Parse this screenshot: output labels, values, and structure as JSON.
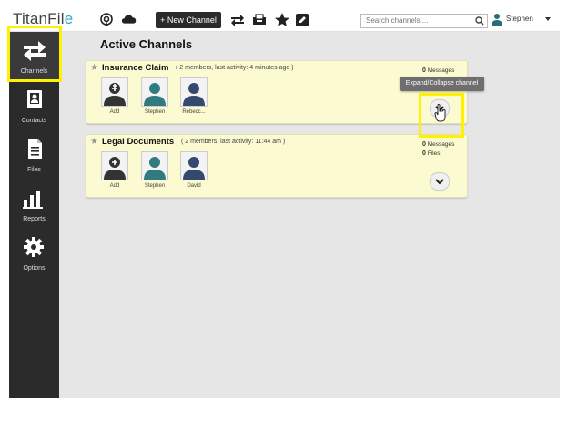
{
  "app": {
    "logo_text": "TitanFil",
    "logo_accent": "e"
  },
  "toolbar": {
    "new_channel_label": "+ New Channel",
    "search_placeholder": "Search channels ...",
    "user_name": "Stephen",
    "icons": [
      "broadcast-icon",
      "cloud-icon",
      "transfer-icon",
      "inbox-icon",
      "star-icon",
      "edit-icon",
      "search-icon",
      "user-icon"
    ]
  },
  "sidebar": {
    "items": [
      {
        "label": "Channels",
        "icon": "channels-icon",
        "active": true
      },
      {
        "label": "Contacts",
        "icon": "contacts-icon"
      },
      {
        "label": "Files",
        "icon": "files-icon"
      },
      {
        "label": "Reports",
        "icon": "reports-icon"
      },
      {
        "label": "Options",
        "icon": "options-icon"
      }
    ]
  },
  "main": {
    "title": "Active Channels",
    "channels": [
      {
        "name": "Insurance Claim",
        "meta": "( 2 members, last activity: 4 minutes ago )",
        "members": [
          "Add",
          "Stephen",
          "Rebecc..."
        ],
        "messages_count": "0",
        "messages_label": "Messages"
      },
      {
        "name": "Legal Documents",
        "meta": "( 2 members, last activity: 11:44 am )",
        "members": [
          "Add",
          "Stephen",
          "David"
        ],
        "messages_count": "0",
        "messages_label": "Messages",
        "files_count": "0",
        "files_label": "Files"
      }
    ],
    "tooltip": "Expand/Collapse channel"
  },
  "colors": {
    "highlight": "#fff200",
    "card_bg": "#fcfad0",
    "sidebar_bg": "#2b2b2b",
    "main_bg": "#e6e6e6"
  }
}
